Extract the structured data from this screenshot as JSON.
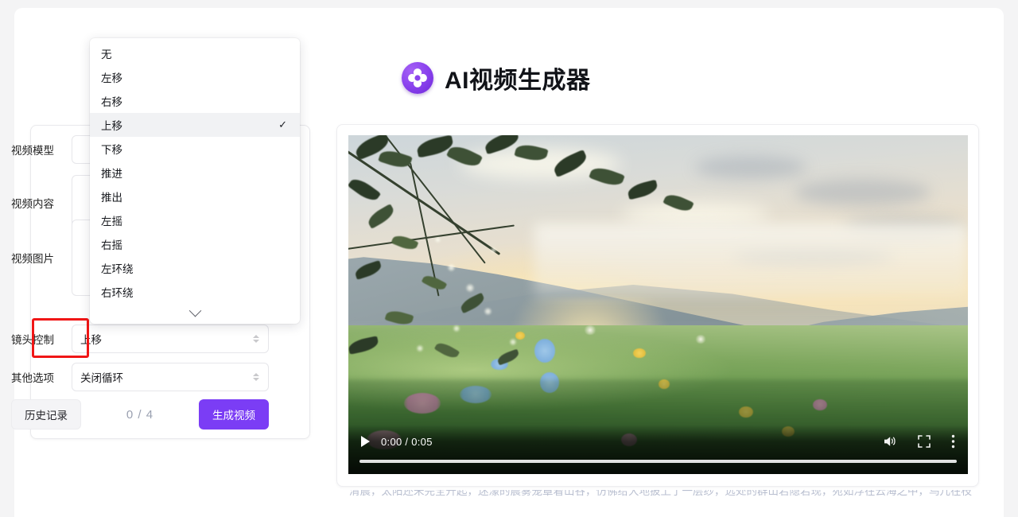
{
  "app": {
    "title": "AI视频生成器",
    "logo_icon": "clover-logo-icon",
    "accent_color": "#7b3df5",
    "page_bg": "#f4f4f5",
    "highlight_color": "#f01616"
  },
  "form": {
    "fields": [
      {
        "label": "视频模型",
        "value": "",
        "name": "video-model"
      },
      {
        "label": "视频内容",
        "value": "",
        "name": "video-content"
      },
      {
        "label": "视频图片",
        "value": "",
        "name": "video-image"
      },
      {
        "label": "镜头控制",
        "value": "上移",
        "name": "camera-control"
      },
      {
        "label": "其他选项",
        "value": "关闭循环",
        "name": "other-options"
      }
    ],
    "actions": {
      "history_label": "历史记录",
      "counter": "0 / 4",
      "generate_label": "生成视频"
    }
  },
  "dropdown": {
    "open_for": "镜头控制",
    "selected": "上移",
    "check_glyph": "✓",
    "scroll_more_icon": "chevron-down-icon",
    "options": [
      "无",
      "左移",
      "右移",
      "上移",
      "下移",
      "推进",
      "推出",
      "左摇",
      "右摇",
      "左环绕",
      "右环绕"
    ]
  },
  "video": {
    "current_time": "0:00",
    "duration": "0:05",
    "time_display": "0:00 / 0:05",
    "progress_percent": 0,
    "play_icon": "play-icon",
    "volume_icon": "volume-icon",
    "fullscreen_icon": "fullscreen-icon",
    "more_icon": "kebab-menu-icon",
    "scene_description": "清晨，太阳还未完全升起，迷濛的晨雾笼罩着山谷，仿佛给大地披上了一层纱，远处的群山若隐若现，宛如沉在云海之中，鸟儿在枝"
  },
  "caption": {
    "text": "清晨，太阳还未完全升起，迷濛的晨雾笼罩着山谷，仿佛给大地披上了一层纱，远处的群山若隐若现，宛如浮在云海之中，鸟儿在枝"
  }
}
